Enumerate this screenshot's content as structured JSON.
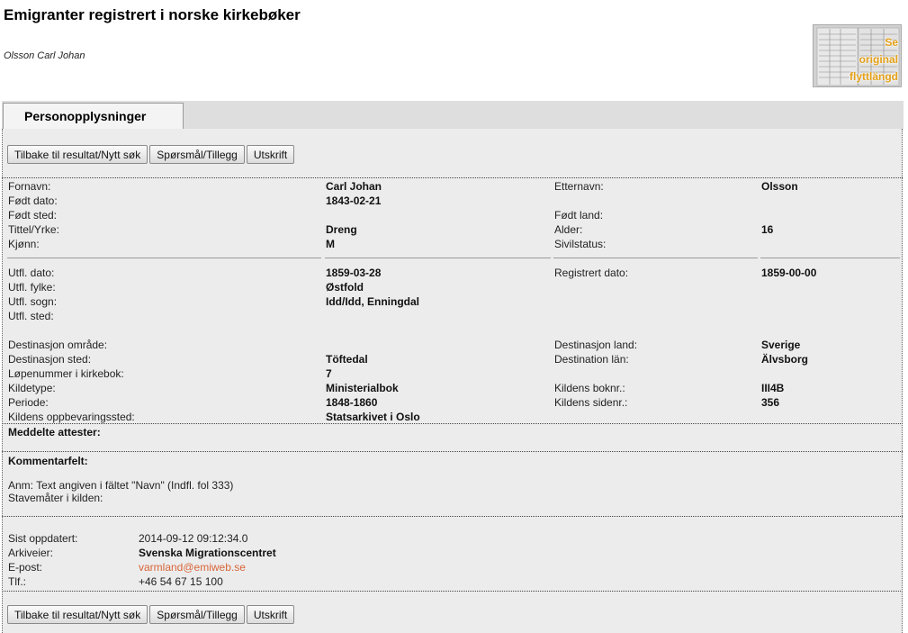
{
  "header": {
    "title": "Emigranter registrert i norske kirkebøker",
    "person": "Olsson Carl Johan",
    "thumbnail": {
      "line1": "Se",
      "line2": "original",
      "line3": "flyttlängd",
      "icon": "document-scan-thumbnail"
    }
  },
  "tab": {
    "label": "Personopplysninger"
  },
  "buttons": {
    "back": "Tilbake til resultat/Nytt søk",
    "question": "Spørsmål/Tillegg",
    "print": "Utskrift"
  },
  "person": {
    "fornavn_label": "Fornavn:",
    "fornavn": "Carl Johan",
    "etternavn_label": "Etternavn:",
    "etternavn": "Olsson",
    "fodt_dato_label": "Født dato:",
    "fodt_dato": "1843-02-21",
    "fodt_sted_label": "Født sted:",
    "fodt_land_label": "Født land:",
    "tittel_label": "Tittel/Yrke:",
    "tittel": "Dreng",
    "alder_label": "Alder:",
    "alder": "16",
    "kjonn_label": "Kjønn:",
    "kjonn": "M",
    "sivilstatus_label": "Sivilstatus:"
  },
  "emigration": {
    "utfl_dato_label": "Utfl. dato:",
    "utfl_dato": "1859-03-28",
    "registrert_label": "Registrert dato:",
    "registrert": "1859-00-00",
    "utfl_fylke_label": "Utfl. fylke:",
    "utfl_fylke": "Østfold",
    "utfl_sogn_label": "Utfl. sogn:",
    "utfl_sogn": "Idd/Idd, Enningdal",
    "utfl_sted_label": "Utfl. sted:",
    "dest_omrade_label": "Destinasjon område:",
    "dest_land_label": "Destinasjon land:",
    "dest_land": "Sverige",
    "dest_sted_label": "Destinasjon sted:",
    "dest_sted": "Töftedal",
    "dest_lan_label": "Destination län:",
    "dest_lan": "Älvsborg",
    "lopenummer_label": "Løpenummer i kirkebok:",
    "lopenummer": "7",
    "kildetype_label": "Kildetype:",
    "kildetype": "Ministerialbok",
    "boknr_label": "Kildens boknr.:",
    "boknr": "III4B",
    "periode_label": "Periode:",
    "periode": "1848-1860",
    "sidenr_label": "Kildens sidenr.:",
    "sidenr": "356",
    "oppbevaring_label": "Kildens oppbevaringssted:",
    "oppbevaring": "Statsarkivet i Oslo"
  },
  "attester": {
    "label": "Meddelte attester:"
  },
  "kommentar": {
    "label": "Kommentarfelt:",
    "anm": "Anm: Text angiven i fältet \"Navn\" (Indfl. fol 333)",
    "stavemater": "Stavemåter i kilden:"
  },
  "footer": {
    "sist_label": "Sist oppdatert:",
    "sist": "2014-09-12 09:12:34.0",
    "arkiveier_label": "Arkiveier:",
    "arkiveier": "Svenska Migrationscentret",
    "epost_label": "E-post:",
    "epost": "varmland@emiweb.se",
    "tlf_label": "Tlf.:",
    "tlf": "+46 54 67 15 100"
  }
}
